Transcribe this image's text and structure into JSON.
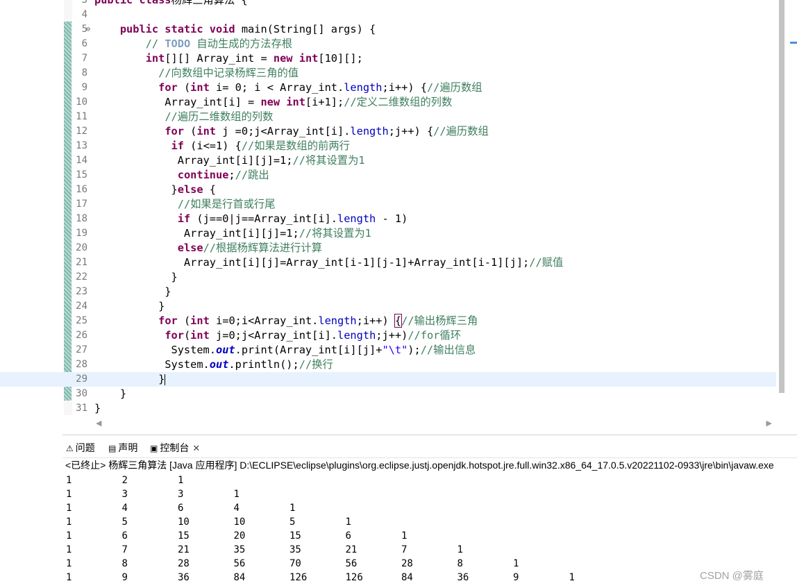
{
  "editor": {
    "lines": [
      {
        "n": "3",
        "tokens": [
          [
            "kw",
            "public class"
          ],
          [
            "",
            ""
          ],
          [
            "",
            "杨辉三角算法 {"
          ]
        ]
      },
      {
        "n": "4",
        "tokens": []
      },
      {
        "n": "5",
        "fold": "⊖",
        "tokens": [
          [
            "",
            "    "
          ],
          [
            "kw",
            "public static void"
          ],
          [
            "",
            " main(String[] args) {"
          ]
        ]
      },
      {
        "n": "6",
        "tokens": [
          [
            "",
            "        "
          ],
          [
            "cm",
            "// "
          ],
          [
            "todo",
            "TODO"
          ],
          [
            "cm",
            " 自动生成的方法存根"
          ]
        ]
      },
      {
        "n": "7",
        "tokens": [
          [
            "",
            "        "
          ],
          [
            "kw",
            "int"
          ],
          [
            "",
            "[][] Array_int = "
          ],
          [
            "kw",
            "new int"
          ],
          [
            "",
            "[10][];"
          ]
        ]
      },
      {
        "n": "8",
        "tokens": [
          [
            "",
            "          "
          ],
          [
            "cm",
            "//向数组中记录杨辉三角的值"
          ]
        ]
      },
      {
        "n": "9",
        "tokens": [
          [
            "",
            "          "
          ],
          [
            "kw",
            "for"
          ],
          [
            "",
            " ("
          ],
          [
            "kw",
            "int"
          ],
          [
            "",
            " i= 0; i < Array_int."
          ],
          [
            "fld",
            "length"
          ],
          [
            "",
            ";i++) {"
          ],
          [
            "cm",
            "//遍历数组"
          ]
        ]
      },
      {
        "n": "10",
        "tokens": [
          [
            "",
            "           Array_int[i] = "
          ],
          [
            "kw",
            "new int"
          ],
          [
            "",
            "[i+1];"
          ],
          [
            "cm",
            "//定义二维数组的列数"
          ]
        ]
      },
      {
        "n": "11",
        "tokens": [
          [
            "",
            "           "
          ],
          [
            "cm",
            "//遍历二维数组的列数"
          ]
        ]
      },
      {
        "n": "12",
        "tokens": [
          [
            "",
            "           "
          ],
          [
            "kw",
            "for"
          ],
          [
            "",
            " ("
          ],
          [
            "kw",
            "int"
          ],
          [
            "",
            " j =0;j<Array_int[i]."
          ],
          [
            "fld",
            "length"
          ],
          [
            "",
            ";j++) {"
          ],
          [
            "cm",
            "//遍历数组"
          ]
        ]
      },
      {
        "n": "13",
        "tokens": [
          [
            "",
            "            "
          ],
          [
            "kw",
            "if"
          ],
          [
            "",
            " (i<=1) {"
          ],
          [
            "cm",
            "//如果是数组的前两行"
          ]
        ]
      },
      {
        "n": "14",
        "tokens": [
          [
            "",
            "             Array_int[i][j]=1;"
          ],
          [
            "cm",
            "//将其设置为1"
          ]
        ]
      },
      {
        "n": "15",
        "tokens": [
          [
            "",
            "             "
          ],
          [
            "kw",
            "continue"
          ],
          [
            "",
            ";"
          ],
          [
            "cm",
            "//跳出"
          ]
        ]
      },
      {
        "n": "16",
        "tokens": [
          [
            "",
            "            }"
          ],
          [
            "kw",
            "else"
          ],
          [
            "",
            " {"
          ]
        ]
      },
      {
        "n": "17",
        "tokens": [
          [
            "",
            "             "
          ],
          [
            "cm",
            "//如果是行首或行尾"
          ]
        ]
      },
      {
        "n": "18",
        "tokens": [
          [
            "",
            "             "
          ],
          [
            "kw",
            "if"
          ],
          [
            "",
            " (j==0|j==Array_int[i]."
          ],
          [
            "fld",
            "length"
          ],
          [
            "",
            " - 1)"
          ]
        ]
      },
      {
        "n": "19",
        "tokens": [
          [
            "",
            "              Array_int[i][j]=1;"
          ],
          [
            "cm",
            "//将其设置为1"
          ]
        ]
      },
      {
        "n": "20",
        "tokens": [
          [
            "",
            "             "
          ],
          [
            "kw",
            "else"
          ],
          [
            "cm",
            "//根据杨辉算法进行计算"
          ]
        ]
      },
      {
        "n": "21",
        "tokens": [
          [
            "",
            "              Array_int[i][j]=Array_int[i-1][j-1]+Array_int[i-1][j];"
          ],
          [
            "cm",
            "//赋值"
          ]
        ]
      },
      {
        "n": "22",
        "tokens": [
          [
            "",
            "            }"
          ]
        ]
      },
      {
        "n": "23",
        "tokens": [
          [
            "",
            "           }"
          ]
        ]
      },
      {
        "n": "24",
        "tokens": [
          [
            "",
            "          }"
          ]
        ]
      },
      {
        "n": "25",
        "tokens": [
          [
            "",
            "          "
          ],
          [
            "kw",
            "for"
          ],
          [
            "",
            " ("
          ],
          [
            "kw",
            "int"
          ],
          [
            "",
            " i=0;i<Array_int."
          ],
          [
            "fld",
            "length"
          ],
          [
            "",
            ";i++) "
          ],
          [
            "box",
            "{"
          ],
          [
            "cm",
            "//输出杨辉三角"
          ]
        ]
      },
      {
        "n": "26",
        "tokens": [
          [
            "",
            "           "
          ],
          [
            "kw",
            "for"
          ],
          [
            "",
            "("
          ],
          [
            "kw",
            "int"
          ],
          [
            "",
            " j=0;j<Array_int[i]."
          ],
          [
            "fld",
            "length"
          ],
          [
            "",
            ";j++)"
          ],
          [
            "cm",
            "//for循环"
          ]
        ]
      },
      {
        "n": "27",
        "tokens": [
          [
            "",
            "            System."
          ],
          [
            "sfld",
            "out"
          ],
          [
            "",
            ".print(Array_int[i][j]+"
          ],
          [
            "str",
            "\"\\t\""
          ],
          [
            "",
            ");"
          ],
          [
            "cm",
            "//输出信息"
          ]
        ]
      },
      {
        "n": "28",
        "tokens": [
          [
            "",
            "           System."
          ],
          [
            "sfld",
            "out"
          ],
          [
            "",
            ".println();"
          ],
          [
            "cm",
            "//换行"
          ]
        ]
      },
      {
        "n": "29",
        "current": true,
        "tokens": [
          [
            "",
            "          }"
          ],
          [
            "caret",
            ""
          ]
        ]
      },
      {
        "n": "30",
        "tokens": [
          [
            "",
            "    }"
          ]
        ]
      },
      {
        "n": "31",
        "tokens": [
          [
            "",
            "}"
          ]
        ]
      }
    ]
  },
  "panel": {
    "tabs": [
      {
        "label": "问题",
        "icon": "problems-icon",
        "glyph": "⚠"
      },
      {
        "label": "声明",
        "icon": "declaration-icon",
        "glyph": "▤"
      },
      {
        "label": "控制台",
        "icon": "console-icon",
        "glyph": "▣"
      }
    ],
    "close_glyph": "✕",
    "console_header": "<已终止> 杨辉三角算法 [Java 应用程序] D:\\ECLIPSE\\eclipse\\plugins\\org.eclipse.justj.openjdk.hotspot.jre.full.win32.x86_64_17.0.5.v20221102-0933\\jre\\bin\\javaw.exe",
    "output_rows": [
      [
        "1",
        "2",
        "1"
      ],
      [
        "1",
        "3",
        "3",
        "1"
      ],
      [
        "1",
        "4",
        "6",
        "4",
        "1"
      ],
      [
        "1",
        "5",
        "10",
        "10",
        "5",
        "1"
      ],
      [
        "1",
        "6",
        "15",
        "20",
        "15",
        "6",
        "1"
      ],
      [
        "1",
        "7",
        "21",
        "35",
        "35",
        "21",
        "7",
        "1"
      ],
      [
        "1",
        "8",
        "28",
        "56",
        "70",
        "56",
        "28",
        "8",
        "1"
      ],
      [
        "1",
        "9",
        "36",
        "84",
        "126",
        "126",
        "84",
        "36",
        "9",
        "1"
      ]
    ]
  },
  "watermark": "CSDN @雾庭"
}
